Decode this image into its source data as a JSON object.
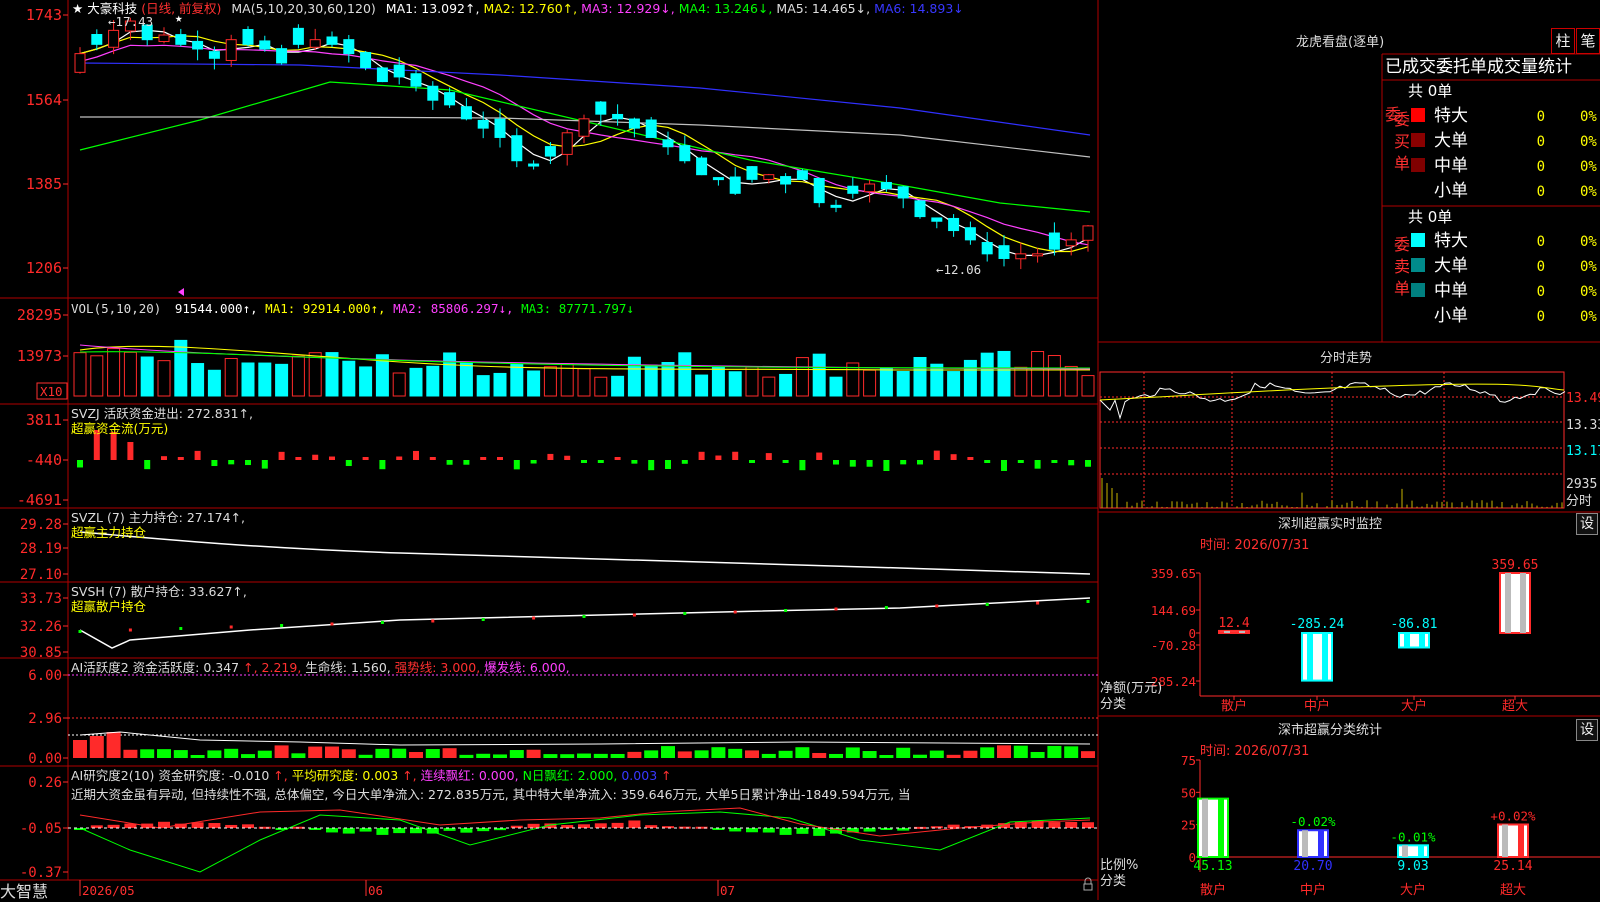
{
  "app": {
    "brand": "大智慧"
  },
  "colors": {
    "up": "#ff2a2a",
    "down": "#00ffff",
    "grid": "#b00000",
    "white": "#ffffff",
    "yellow": "#ffff00",
    "magenta": "#ff40ff",
    "green": "#00ff00",
    "gray": "#c0c0c0",
    "blue": "#3030ff"
  },
  "main": {
    "title_star": "★",
    "stock_name": "大豪科技",
    "period": "(日线, 前复权)",
    "ma_prefix": "MA(5,10,20,30,60,120)",
    "ma1": "MA1: 13.092↑,",
    "ma2": "MA2: 12.760↑,",
    "ma3": "MA3: 12.929↓,",
    "ma4": "MA4: 13.246↓,",
    "ma5": "MA5: 14.465↓,",
    "ma6": "MA6: 14.893↓",
    "y_labels": [
      "1743",
      "1564",
      "1385",
      "1206"
    ],
    "high_label": "←17.43",
    "low_label": "←12.06",
    "marker_star": "★"
  },
  "vol": {
    "label": "VOL(5,10,20)",
    "value": "91544.000↑,",
    "ma1": "MA1: 92914.000↑,",
    "ma2": "MA2: 85806.297↓,",
    "ma3": "MA3: 87771.797↓",
    "y_labels": [
      "28295",
      "13973"
    ],
    "unit": "X10"
  },
  "svzj": {
    "line1": "SVZJ  活跃资金进出: 272.831↑,",
    "line2": "超赢资金流(万元)",
    "y_labels": [
      "3811",
      "-440",
      "-4691"
    ]
  },
  "svzl": {
    "line1": "SVZL (7) 主力持仓: 27.174↑,",
    "line2": "超赢主力持仓",
    "y_labels": [
      "29.28",
      "28.19",
      "27.10"
    ]
  },
  "svsh": {
    "line1": "SVSH (7) 散户持仓: 33.627↑,",
    "line2": "超赢散户持仓",
    "y_labels": [
      "33.73",
      "32.26",
      "30.85"
    ]
  },
  "ai_act": {
    "a": "AI活跃度2 资金活跃度: 0.347",
    "b": "↑, 2.219,",
    "c": " 生命线: 1.560,",
    "d": " 强势线: 3.000,",
    "e": " 爆发线: 6.000,",
    "y_labels": [
      "6.00",
      "2.96",
      "0.00"
    ]
  },
  "ai_res": {
    "a": "AI研究度2(10) 资金研究度: -0.010",
    "b": "↑,",
    "c": " 平均研究度: 0.003",
    "d": "↑,",
    "e": " 连续飘红: 0.000,",
    "f": " N日飘红: 2.000,",
    "g": " 0.003",
    "h": "↑",
    "note": "近期大资金虽有异动, 但持续性不强, 总体偏空, 今日大单净流入: 272.835万元, 其中特大单净流入: 359.646万元, 大单5日累计净出-1849.594万元, 当",
    "y_labels": [
      "0.26",
      "-0.05",
      "-0.37"
    ]
  },
  "x_axis": {
    "labels": [
      "2026/05",
      "06",
      "07"
    ]
  },
  "right": {
    "dragon_title": "龙虎看盘(逐单)",
    "tab_bar": "柱",
    "tab_pen": "笔",
    "header": "已成交委托单成交量统计",
    "buy_label": "委买单",
    "sell_label": "委卖单",
    "buy_total": "共 0单",
    "sell_total": "共 0单",
    "rows": [
      {
        "name": "特大",
        "count": "0",
        "pct": "0%"
      },
      {
        "name": "大单",
        "count": "0",
        "pct": "0%"
      },
      {
        "name": "中单",
        "count": "0",
        "pct": "0%"
      },
      {
        "name": "小单",
        "count": "0",
        "pct": "0%"
      }
    ],
    "buy_colors": [
      "#ff0000",
      "#8b0000",
      "#800000",
      "#000000"
    ],
    "sell_colors": [
      "#00ffff",
      "#008b8b",
      "#008080",
      "#000000"
    ],
    "minute_title": "分时走势",
    "minute_y": [
      "13.49",
      "13.33",
      "13.17"
    ],
    "minute_vol": "2935",
    "minute_vol_label": "分时",
    "sz_title": "深圳超赢实时监控",
    "sz_time": "时间: 2026/07/31",
    "sz_y": [
      "359.65",
      "144.69",
      "0",
      "-70.28",
      "-285.24"
    ],
    "sz_ylabel": "净额(万元)",
    "sz_xlabel": "分类",
    "sz_cats": [
      "散户",
      "中户",
      "大户",
      "超大"
    ],
    "sz_values": [
      "12.4",
      "-285.24",
      "-86.81",
      "359.65"
    ],
    "cls_title": "深市超赢分类统计",
    "cls_time": "时间: 2026/07/31",
    "cls_y": [
      "75",
      "50",
      "25",
      "0"
    ],
    "cls_ylabel": "比例%",
    "cls_xlabel": "分类",
    "cls_cats": [
      "散户",
      "中户",
      "大户",
      "超大"
    ],
    "cls_top": [
      "",
      "-0.02%",
      "-0.01%",
      "+0.02%"
    ],
    "cls_values": [
      "45.13",
      "20.70",
      "9.03",
      "25.14"
    ],
    "settings": "设"
  }
}
